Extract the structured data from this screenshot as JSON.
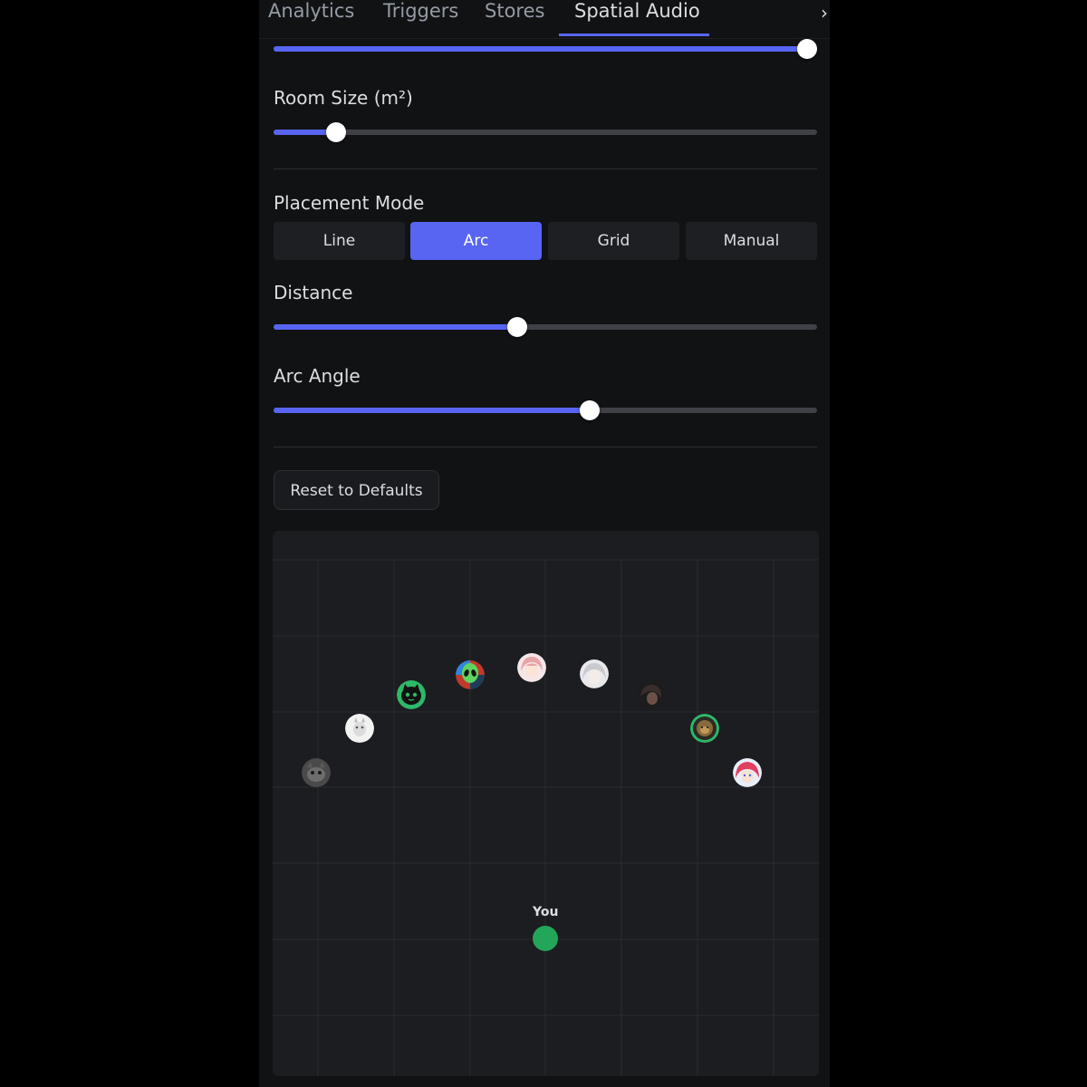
{
  "tabs": [
    {
      "label": "Analytics",
      "active": false
    },
    {
      "label": "Triggers",
      "active": false
    },
    {
      "label": "Stores",
      "active": false
    },
    {
      "label": "Spatial Audio",
      "active": true
    }
  ],
  "top_slider": {
    "value_fraction": 1.0
  },
  "room_size": {
    "label": "Room Size (m²)",
    "value_fraction": 0.115
  },
  "placement_mode": {
    "label": "Placement Mode",
    "options": [
      "Line",
      "Arc",
      "Grid",
      "Manual"
    ],
    "selected": "Arc"
  },
  "distance": {
    "label": "Distance",
    "value_fraction": 0.448
  },
  "arc_angle": {
    "label": "Arc Angle",
    "value_fraction": 0.582
  },
  "reset_button": {
    "label": "Reset to Defaults"
  },
  "listener": {
    "label": "You"
  },
  "colors": {
    "accent": "#5865f2",
    "listener": "#23a55a",
    "panel_bg": "#111214",
    "canvas_bg": "#1c1d21"
  },
  "participants": [
    {
      "icon": "gray-cat-avatar-icon"
    },
    {
      "icon": "white-cat-avatar-icon"
    },
    {
      "icon": "black-cat-avatar-icon"
    },
    {
      "icon": "alien-avatar-icon"
    },
    {
      "icon": "anime-pink-hair-avatar-icon"
    },
    {
      "icon": "anime-white-hair-avatar-icon"
    },
    {
      "icon": "dark-hair-avatar-icon"
    },
    {
      "icon": "lion-avatar-icon"
    },
    {
      "icon": "anime-red-hair-avatar-icon"
    }
  ]
}
